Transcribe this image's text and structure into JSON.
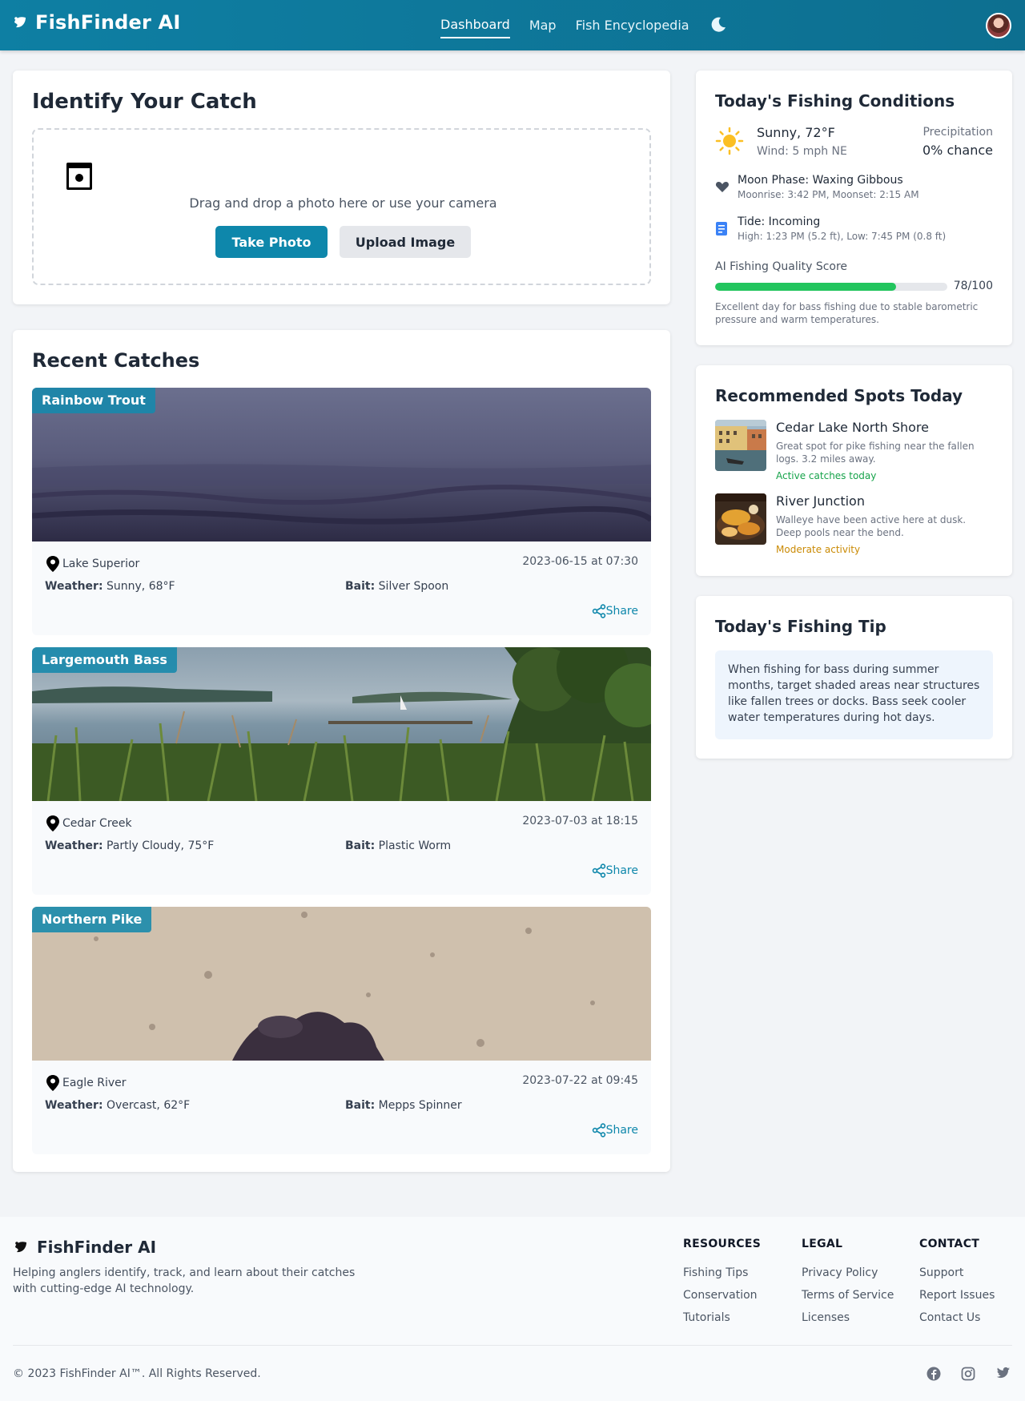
{
  "app": {
    "name": "FishFinder AI"
  },
  "nav": {
    "items": [
      "Dashboard",
      "Map",
      "Fish Encyclopedia"
    ],
    "active": "Dashboard"
  },
  "identify": {
    "title": "Identify Your Catch",
    "drop_text": "Drag and drop a photo here or use your camera",
    "take_photo": "Take Photo",
    "upload_image": "Upload Image"
  },
  "recent": {
    "title": "Recent Catches",
    "share_label": "Share",
    "weather_label": "Weather:",
    "bait_label": "Bait:",
    "items": [
      {
        "species": "Rainbow Trout",
        "location": "Lake Superior",
        "date": "2023-06-15 at 07:30",
        "weather": "Sunny, 68°F",
        "bait": "Silver Spoon"
      },
      {
        "species": "Largemouth Bass",
        "location": "Cedar Creek",
        "date": "2023-07-03 at 18:15",
        "weather": "Partly Cloudy, 75°F",
        "bait": "Plastic Worm"
      },
      {
        "species": "Northern Pike",
        "location": "Eagle River",
        "date": "2023-07-22 at 09:45",
        "weather": "Overcast, 62°F",
        "bait": "Mepps Spinner"
      }
    ]
  },
  "conditions": {
    "title": "Today's Fishing Conditions",
    "weather": "Sunny, 72°F",
    "wind": "Wind: 5 mph NE",
    "precip_label": "Precipitation",
    "precip_value": "0% chance",
    "moon_phase": "Moon Phase: Waxing Gibbous",
    "moon_times": "Moonrise: 3:42 PM, Moonset: 2:15 AM",
    "tide": "Tide: Incoming",
    "tide_times": "High: 1:23 PM (5.2 ft), Low: 7:45 PM (0.8 ft)",
    "score_label": "AI Fishing Quality Score",
    "score_value": "78/100",
    "score_fraction": 0.78,
    "score_note": "Excellent day for bass fishing due to stable barometric pressure and warm temperatures."
  },
  "spots": {
    "title": "Recommended Spots Today",
    "items": [
      {
        "name": "Cedar Lake North Shore",
        "desc": "Great spot for pike fishing near the fallen logs. 3.2 miles away.",
        "status": "Active catches today",
        "status_color": "#16a34a"
      },
      {
        "name": "River Junction",
        "desc": "Walleye have been active here at dusk. Deep pools near the bend.",
        "status": "Moderate activity",
        "status_color": "#ca8a04"
      }
    ]
  },
  "tip": {
    "title": "Today's Fishing Tip",
    "text": "When fishing for bass during summer months, target shaded areas near structures like fallen trees or docks. Bass seek cooler water temperatures during hot days."
  },
  "footer": {
    "brand": "FishFinder AI",
    "description": "Helping anglers identify, track, and learn about their catches with cutting-edge AI technology.",
    "columns": [
      {
        "heading": "RESOURCES",
        "links": [
          "Fishing Tips",
          "Conservation",
          "Tutorials"
        ]
      },
      {
        "heading": "LEGAL",
        "links": [
          "Privacy Policy",
          "Terms of Service",
          "Licenses"
        ]
      },
      {
        "heading": "CONTACT",
        "links": [
          "Support",
          "Report Issues",
          "Contact Us"
        ]
      }
    ],
    "copyright": "© 2023 FishFinder AI™. All Rights Reserved.",
    "social_icons": [
      "facebook-icon",
      "instagram-icon",
      "twitter-icon"
    ]
  },
  "colors": {
    "header": "#0e7fa3",
    "accent": "#0e87ab",
    "score": "#22c55e"
  }
}
